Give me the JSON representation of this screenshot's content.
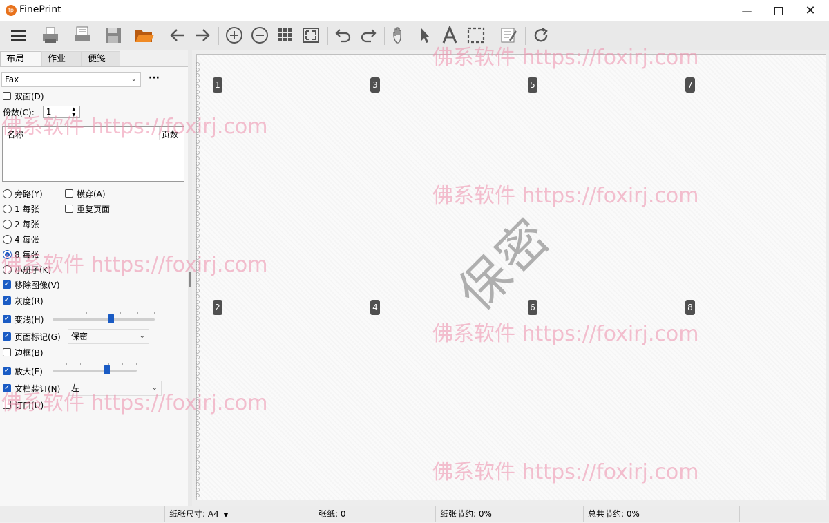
{
  "app": {
    "title": "FinePrint",
    "icon_letters": "fp"
  },
  "window_controls": [
    "minimize-icon",
    "maximize-icon",
    "close-icon"
  ],
  "toolbar_icons": [
    "menu-icon",
    "print-icon",
    "print-settings-icon",
    "save-icon",
    "open-folder-icon",
    "back-arrow-icon",
    "forward-arrow-icon",
    "zoom-in-icon",
    "zoom-out-icon",
    "thumbnails-icon",
    "fit-page-icon",
    "undo-icon",
    "redo-icon",
    "hand-icon",
    "pointer-icon",
    "text-icon",
    "select-rect-icon",
    "edit-page-icon",
    "refresh-icon"
  ],
  "tabs": [
    "布局",
    "作业",
    "便笺"
  ],
  "printer": {
    "selected": "Fax",
    "more": "···"
  },
  "duplex_label": "双面(D)",
  "copies": {
    "label": "份数(C):",
    "value": "1"
  },
  "job_list": {
    "col_name": "名称",
    "col_pages": "页数"
  },
  "layout_options": {
    "bypass": "旁路(Y)",
    "one_per": "1 每张",
    "two_per": "2 每张",
    "four_per": "4 每张",
    "eight_per": "8 每张",
    "booklet": "小册子(K)",
    "across": "横穿(A)",
    "repeat_page": "重复页面"
  },
  "options": {
    "remove_images": "移除图像(V)",
    "grayscale": "灰度(R)",
    "lighten": "变浅(H)",
    "lighten_level": 0.58,
    "header_mark": "页面标记(G)",
    "header_mark_value": "保密",
    "border": "边框(B)",
    "zoom": "放大(E)",
    "zoom_level": 0.66,
    "binding": "文档装订(N)",
    "binding_value": "左",
    "gutter": "订口(U)"
  },
  "preview": {
    "pages": [
      "1",
      "3",
      "5",
      "7",
      "2",
      "4",
      "6",
      "8"
    ],
    "stamp": "保密"
  },
  "watermark": "佛系软件 https://foxirj.com",
  "status": {
    "paper_size": "纸张尺寸: A4",
    "sheets": "张纸:   0",
    "paper_saved": "纸张节约:   0%",
    "total_saved": "总共节约:   0%"
  },
  "colors": {
    "accent": "#1a5bc4",
    "app_icon": "#e8721c",
    "folder": "#e8721c"
  }
}
